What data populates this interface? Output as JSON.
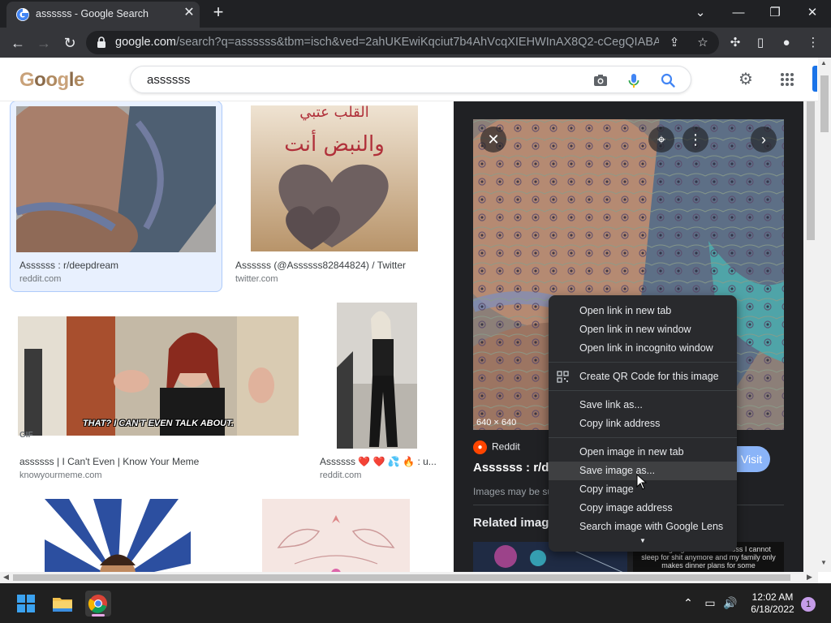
{
  "browser": {
    "tab_title": "assssss - Google Search",
    "url_host": "google.com",
    "url_path": "/search?q=assssss&tbm=isch&ved=2ahUKEwiKqciut7b4AhVcqXIEHWInAX8Q2-cCegQIABAA&o...",
    "window_controls": [
      "⌄",
      "—",
      "❐",
      "✕"
    ]
  },
  "search": {
    "query": "assssss",
    "logo_text": "Google"
  },
  "results": [
    {
      "title": "Assssss : r/deepdream",
      "source": "reddit.com"
    },
    {
      "title": "Assssss (@Assssss82844824) / Twitter",
      "source": "twitter.com"
    },
    {
      "title": "assssss | I Can't Even | Know Your Meme",
      "source": "knowyourmeme.com",
      "badge": "GIF",
      "caption": "THAT? I CAN'T EVEN TALK ABOUT."
    },
    {
      "title": "Assssss ❤️ ❤️ 💦 🔥 : u...",
      "source": "reddit.com"
    }
  ],
  "arabic_caption": {
    "line1": "القلب عتبي",
    "line2": "والنبض أنت"
  },
  "preview": {
    "dimensions": "640 × 640",
    "source_name": "Reddit",
    "title": "Assssss : r/deepdream",
    "visit_label": "Visit",
    "note": "Images may be subject to copyright.",
    "related_heading": "Related images",
    "related_text": "Working nights sucks assssss I cannot sleep for shit anymore and my family only makes dinner plans for some"
  },
  "context_menu": {
    "group1": [
      "Open link in new tab",
      "Open link in new window",
      "Open link in incognito window"
    ],
    "qr": "Create QR Code for this image",
    "group2": [
      "Save link as...",
      "Copy link address"
    ],
    "group3": [
      "Open image in new tab",
      "Save image as...",
      "Copy image",
      "Copy image address",
      "Search image with Google Lens"
    ],
    "hovered": "Save image as..."
  },
  "taskbar": {
    "time": "12:02 AM",
    "date": "6/18/2022",
    "notifications": "1"
  },
  "colors": {
    "accent": "#1a73e8",
    "preview_bg": "#202124",
    "menu_bg": "#292a2d",
    "selected_card": "#e8f0fe"
  }
}
